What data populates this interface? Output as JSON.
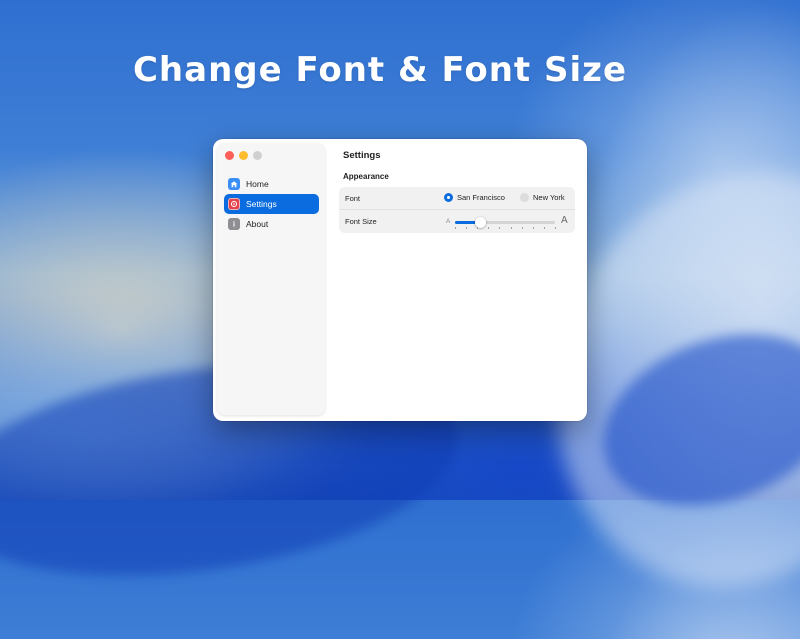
{
  "headline": "Change Font & Font Size",
  "window": {
    "sidebar": {
      "items": [
        {
          "label": "Home",
          "icon": "house-icon",
          "active": false
        },
        {
          "label": "Settings",
          "icon": "settings-icon",
          "active": true
        },
        {
          "label": "About",
          "icon": "info-icon",
          "active": false
        }
      ]
    },
    "main": {
      "title": "Settings",
      "section": "Appearance",
      "font_row": {
        "label": "Font",
        "options": [
          "San Francisco",
          "New York"
        ],
        "selected": "San Francisco"
      },
      "font_size_row": {
        "label": "Font Size",
        "small_glyph": "A",
        "large_glyph": "A",
        "value_fraction": 0.25,
        "ticks": 10
      }
    }
  },
  "colors": {
    "accent": "#0a6cde",
    "close": "#fe5f57",
    "minimize": "#febc2e",
    "zoom_inactive": "#d0d0d0"
  }
}
